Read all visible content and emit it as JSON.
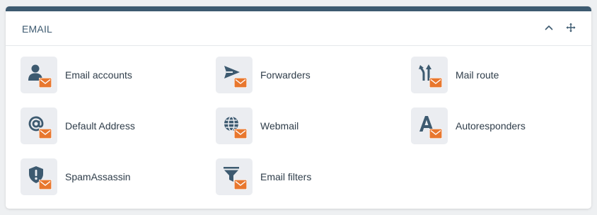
{
  "panel": {
    "title": "EMAIL",
    "accent_color": "#3d5a70",
    "collapse_icon": "chevron-up-icon",
    "move_icon": "move-arrows-icon"
  },
  "items": [
    {
      "label": "Email accounts",
      "icon": "user-icon"
    },
    {
      "label": "Forwarders",
      "icon": "send-icon"
    },
    {
      "label": "Mail route",
      "icon": "route-arrows-icon"
    },
    {
      "label": "Default Address",
      "icon": "at-sign-icon"
    },
    {
      "label": "Webmail",
      "icon": "globe-icon"
    },
    {
      "label": "Autoresponders",
      "icon": "letter-a-icon"
    },
    {
      "label": "SpamAssassin",
      "icon": "shield-alert-icon"
    },
    {
      "label": "Email filters",
      "icon": "funnel-icon"
    }
  ],
  "colors": {
    "icon": "#3d5a70",
    "envelope": "#e8772e",
    "tile_bg": "#ebedf1"
  }
}
